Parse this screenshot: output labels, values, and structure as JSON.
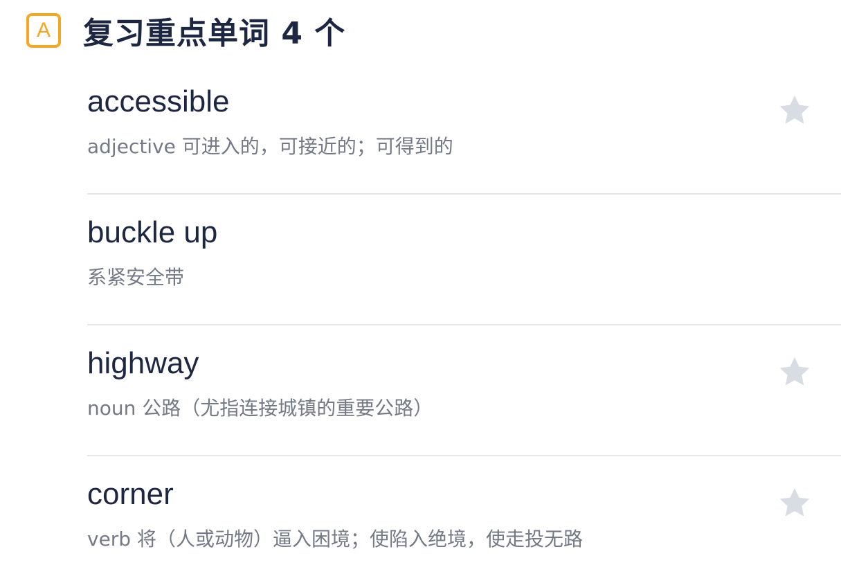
{
  "header": {
    "badge_letter": "A",
    "title": "复习重点单词 4 个",
    "accent_color": "#f5a623"
  },
  "words": [
    {
      "word": "accessible",
      "meaning": "adjective 可进入的，可接近的；可得到的",
      "starred": false,
      "star_visible": true
    },
    {
      "word": "buckle up",
      "meaning": "系紧安全带",
      "starred": false,
      "star_visible": false
    },
    {
      "word": "highway",
      "meaning": "noun 公路（尤指连接城镇的重要公路）",
      "starred": false,
      "star_visible": true
    },
    {
      "word": "corner",
      "meaning": "verb 将（人或动物）逼入困境；使陷入绝境，使走投无路",
      "starred": false,
      "star_visible": true
    }
  ],
  "colors": {
    "text_primary": "#1d2742",
    "text_secondary": "#737a86",
    "divider": "#e4e6ea",
    "star_inactive": "#d8dde3"
  }
}
